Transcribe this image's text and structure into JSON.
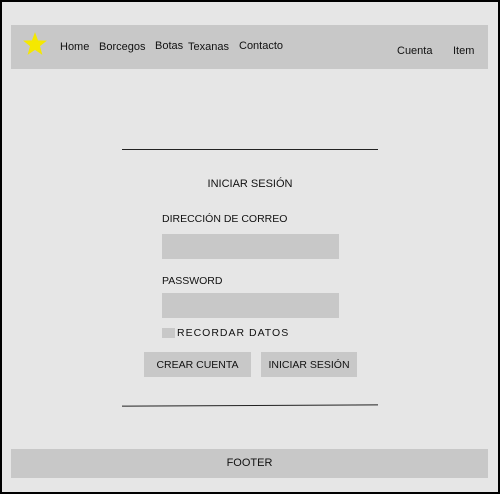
{
  "colors": {
    "logo_star": "#f5e800",
    "panel": "#c8c8c8",
    "background": "#e6e6e6"
  },
  "header": {
    "logo_icon": "star-icon",
    "nav_links": [
      "Home",
      "Borcegos",
      "Botas",
      "Texanas",
      "Contacto"
    ],
    "right_links": [
      "Cuenta",
      "Item"
    ]
  },
  "login": {
    "title": "INICIAR SESIÓN",
    "email_label": "DIRECCIÓN DE CORREO",
    "email_value": "",
    "password_label": "PASSWORD",
    "password_value": "",
    "remember_label": "RECORDAR DATOS",
    "create_account_button": "CREAR CUENTA",
    "login_button": "INICIAR SESIÓN"
  },
  "footer": {
    "label": "FOOTER"
  }
}
